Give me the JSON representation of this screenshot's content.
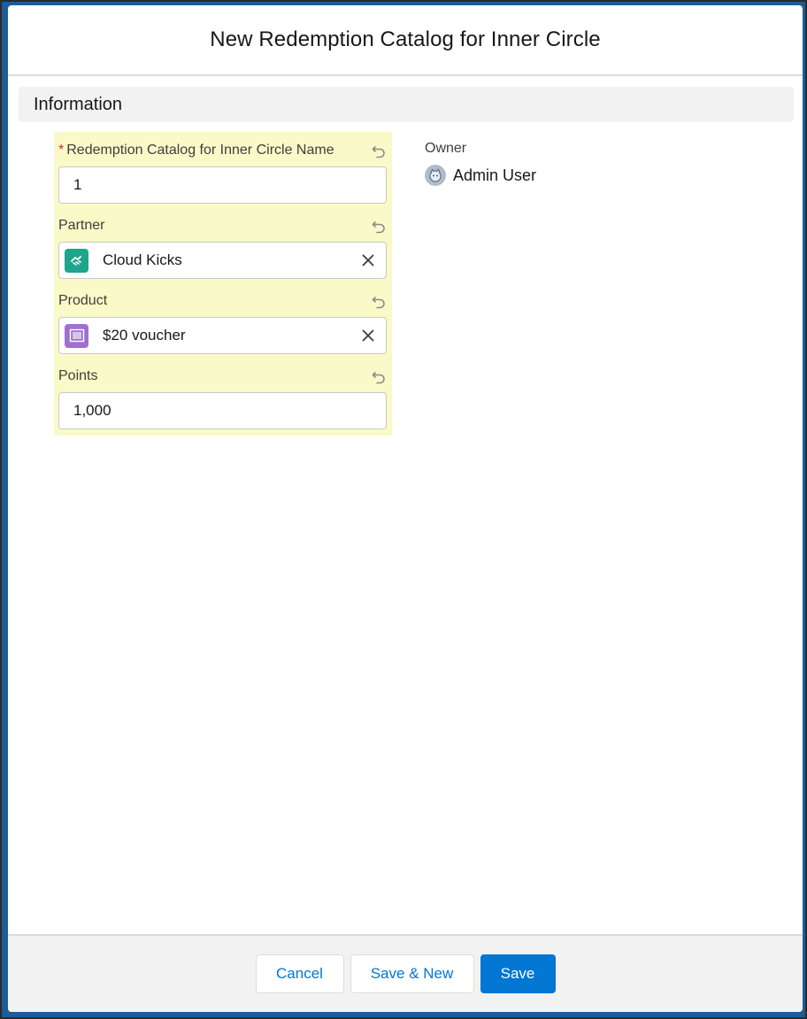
{
  "modal": {
    "title": "New Redemption Catalog for Inner Circle"
  },
  "section": {
    "title": "Information"
  },
  "fields": {
    "name": {
      "label": "Redemption Catalog for Inner Circle Name",
      "required_marker": "*",
      "value": "1"
    },
    "partner": {
      "label": "Partner",
      "value": "Cloud Kicks",
      "icon": "partner-handshake-icon",
      "icon_color": "#1fa58b"
    },
    "product": {
      "label": "Product",
      "value": "$20 voucher",
      "icon": "product-barcode-icon",
      "icon_color": "#a06fd0"
    },
    "points": {
      "label": "Points",
      "value": "1,000"
    }
  },
  "owner": {
    "label": "Owner",
    "name": "Admin User",
    "avatar_icon": "user-avatar-icon"
  },
  "footer": {
    "cancel_label": "Cancel",
    "save_new_label": "Save & New",
    "save_label": "Save"
  },
  "colors": {
    "brand": "#0176d3",
    "highlight": "#fafac8",
    "required": "#c23934"
  }
}
